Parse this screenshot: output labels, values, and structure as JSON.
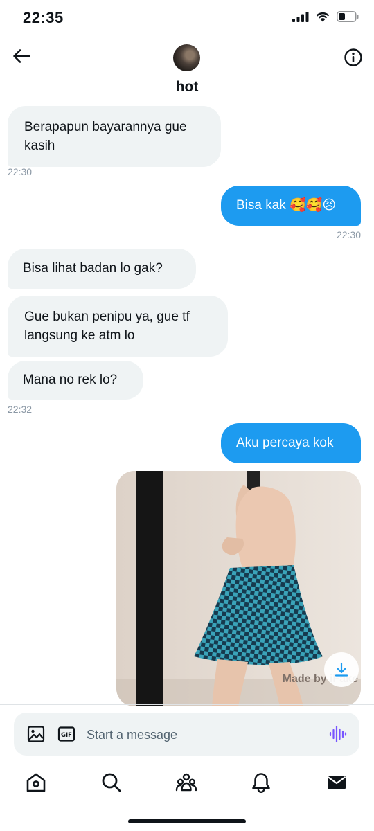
{
  "status": {
    "time": "22:35"
  },
  "header": {
    "name": "hot"
  },
  "messages": [
    {
      "dir": "in",
      "text": "Berapapun bayarannya gue kasih"
    },
    {
      "time": "22:30"
    },
    {
      "dir": "out",
      "text": "Bisa kak 🥰🥰😣"
    },
    {
      "time": "22:30"
    },
    {
      "dir": "in",
      "text": "Bisa lihat badan lo gak?"
    },
    {
      "dir": "in",
      "text": "Gue bukan penipu ya, gue tf langsung ke atm lo"
    },
    {
      "dir": "in",
      "text": "Mana no rek lo?"
    },
    {
      "time": "22:32"
    },
    {
      "dir": "out",
      "text": "Aku percaya kok"
    }
  ],
  "photo": {
    "watermark": "Made by iFake"
  },
  "composer": {
    "placeholder": "Start a message"
  },
  "icons": {
    "back": "arrow-left-icon",
    "info": "info-icon",
    "image": "image-icon",
    "gif": "gif-icon",
    "voice": "voice-wave-icon",
    "home": "home-icon",
    "search": "search-icon",
    "communities": "people-icon",
    "notifications": "bell-icon",
    "messages": "envelope-icon"
  },
  "colors": {
    "accent": "#1d9bf0",
    "incoming_bubble": "#eff3f4",
    "voice": "#7856ff"
  }
}
